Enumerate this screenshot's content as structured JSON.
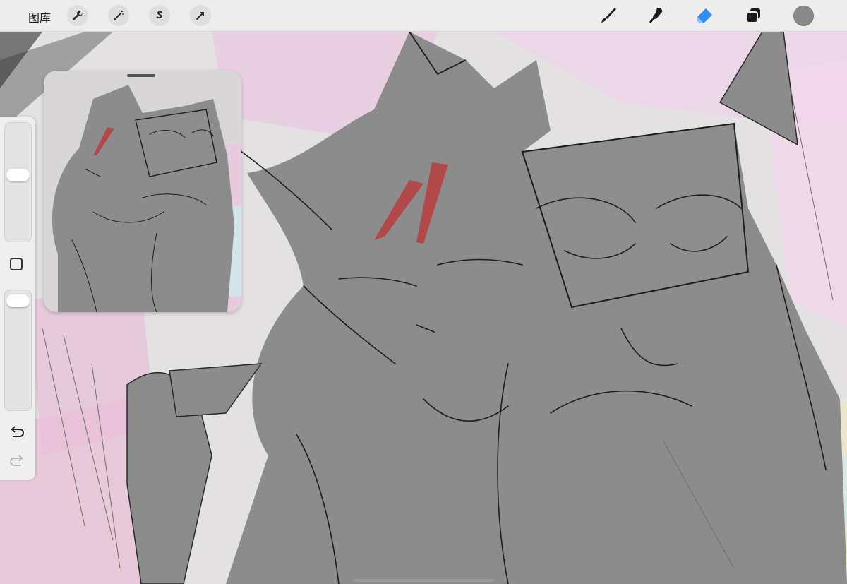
{
  "toolbar": {
    "gallery_label": "图库",
    "left_tools": [
      "wrench-icon",
      "magic-wand-icon",
      "selection-s-icon",
      "transform-arrow-icon"
    ],
    "right_tools": [
      "brush-icon",
      "smudge-icon",
      "eraser-icon",
      "layers-icon",
      "color-swatch"
    ],
    "active_tool": "eraser-icon",
    "accent_color": "#2f8ef4",
    "current_color": "#8a8a8a"
  },
  "sidebar": {
    "controls": [
      "brush-size-slider",
      "modify-button",
      "opacity-slider",
      "undo-icon",
      "redo-icon"
    ]
  },
  "reference": {
    "visible": true
  }
}
